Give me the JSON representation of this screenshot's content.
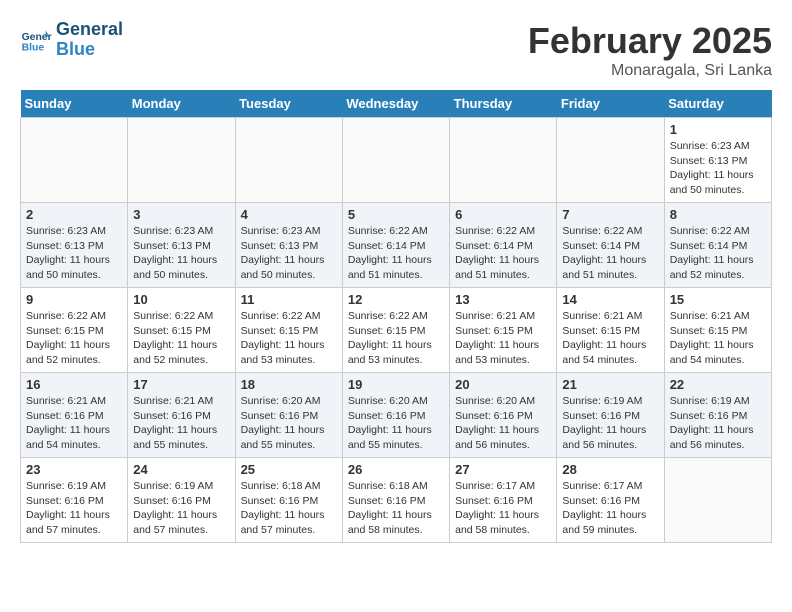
{
  "header": {
    "logo_line1": "General",
    "logo_line2": "Blue",
    "month": "February 2025",
    "location": "Monaragala, Sri Lanka"
  },
  "weekdays": [
    "Sunday",
    "Monday",
    "Tuesday",
    "Wednesday",
    "Thursday",
    "Friday",
    "Saturday"
  ],
  "weeks": [
    [
      {
        "day": "",
        "info": ""
      },
      {
        "day": "",
        "info": ""
      },
      {
        "day": "",
        "info": ""
      },
      {
        "day": "",
        "info": ""
      },
      {
        "day": "",
        "info": ""
      },
      {
        "day": "",
        "info": ""
      },
      {
        "day": "1",
        "info": "Sunrise: 6:23 AM\nSunset: 6:13 PM\nDaylight: 11 hours\nand 50 minutes."
      }
    ],
    [
      {
        "day": "2",
        "info": "Sunrise: 6:23 AM\nSunset: 6:13 PM\nDaylight: 11 hours\nand 50 minutes."
      },
      {
        "day": "3",
        "info": "Sunrise: 6:23 AM\nSunset: 6:13 PM\nDaylight: 11 hours\nand 50 minutes."
      },
      {
        "day": "4",
        "info": "Sunrise: 6:23 AM\nSunset: 6:13 PM\nDaylight: 11 hours\nand 50 minutes."
      },
      {
        "day": "5",
        "info": "Sunrise: 6:22 AM\nSunset: 6:14 PM\nDaylight: 11 hours\nand 51 minutes."
      },
      {
        "day": "6",
        "info": "Sunrise: 6:22 AM\nSunset: 6:14 PM\nDaylight: 11 hours\nand 51 minutes."
      },
      {
        "day": "7",
        "info": "Sunrise: 6:22 AM\nSunset: 6:14 PM\nDaylight: 11 hours\nand 51 minutes."
      },
      {
        "day": "8",
        "info": "Sunrise: 6:22 AM\nSunset: 6:14 PM\nDaylight: 11 hours\nand 52 minutes."
      }
    ],
    [
      {
        "day": "9",
        "info": "Sunrise: 6:22 AM\nSunset: 6:15 PM\nDaylight: 11 hours\nand 52 minutes."
      },
      {
        "day": "10",
        "info": "Sunrise: 6:22 AM\nSunset: 6:15 PM\nDaylight: 11 hours\nand 52 minutes."
      },
      {
        "day": "11",
        "info": "Sunrise: 6:22 AM\nSunset: 6:15 PM\nDaylight: 11 hours\nand 53 minutes."
      },
      {
        "day": "12",
        "info": "Sunrise: 6:22 AM\nSunset: 6:15 PM\nDaylight: 11 hours\nand 53 minutes."
      },
      {
        "day": "13",
        "info": "Sunrise: 6:21 AM\nSunset: 6:15 PM\nDaylight: 11 hours\nand 53 minutes."
      },
      {
        "day": "14",
        "info": "Sunrise: 6:21 AM\nSunset: 6:15 PM\nDaylight: 11 hours\nand 54 minutes."
      },
      {
        "day": "15",
        "info": "Sunrise: 6:21 AM\nSunset: 6:15 PM\nDaylight: 11 hours\nand 54 minutes."
      }
    ],
    [
      {
        "day": "16",
        "info": "Sunrise: 6:21 AM\nSunset: 6:16 PM\nDaylight: 11 hours\nand 54 minutes."
      },
      {
        "day": "17",
        "info": "Sunrise: 6:21 AM\nSunset: 6:16 PM\nDaylight: 11 hours\nand 55 minutes."
      },
      {
        "day": "18",
        "info": "Sunrise: 6:20 AM\nSunset: 6:16 PM\nDaylight: 11 hours\nand 55 minutes."
      },
      {
        "day": "19",
        "info": "Sunrise: 6:20 AM\nSunset: 6:16 PM\nDaylight: 11 hours\nand 55 minutes."
      },
      {
        "day": "20",
        "info": "Sunrise: 6:20 AM\nSunset: 6:16 PM\nDaylight: 11 hours\nand 56 minutes."
      },
      {
        "day": "21",
        "info": "Sunrise: 6:19 AM\nSunset: 6:16 PM\nDaylight: 11 hours\nand 56 minutes."
      },
      {
        "day": "22",
        "info": "Sunrise: 6:19 AM\nSunset: 6:16 PM\nDaylight: 11 hours\nand 56 minutes."
      }
    ],
    [
      {
        "day": "23",
        "info": "Sunrise: 6:19 AM\nSunset: 6:16 PM\nDaylight: 11 hours\nand 57 minutes."
      },
      {
        "day": "24",
        "info": "Sunrise: 6:19 AM\nSunset: 6:16 PM\nDaylight: 11 hours\nand 57 minutes."
      },
      {
        "day": "25",
        "info": "Sunrise: 6:18 AM\nSunset: 6:16 PM\nDaylight: 11 hours\nand 57 minutes."
      },
      {
        "day": "26",
        "info": "Sunrise: 6:18 AM\nSunset: 6:16 PM\nDaylight: 11 hours\nand 58 minutes."
      },
      {
        "day": "27",
        "info": "Sunrise: 6:17 AM\nSunset: 6:16 PM\nDaylight: 11 hours\nand 58 minutes."
      },
      {
        "day": "28",
        "info": "Sunrise: 6:17 AM\nSunset: 6:16 PM\nDaylight: 11 hours\nand 59 minutes."
      },
      {
        "day": "",
        "info": ""
      }
    ]
  ]
}
